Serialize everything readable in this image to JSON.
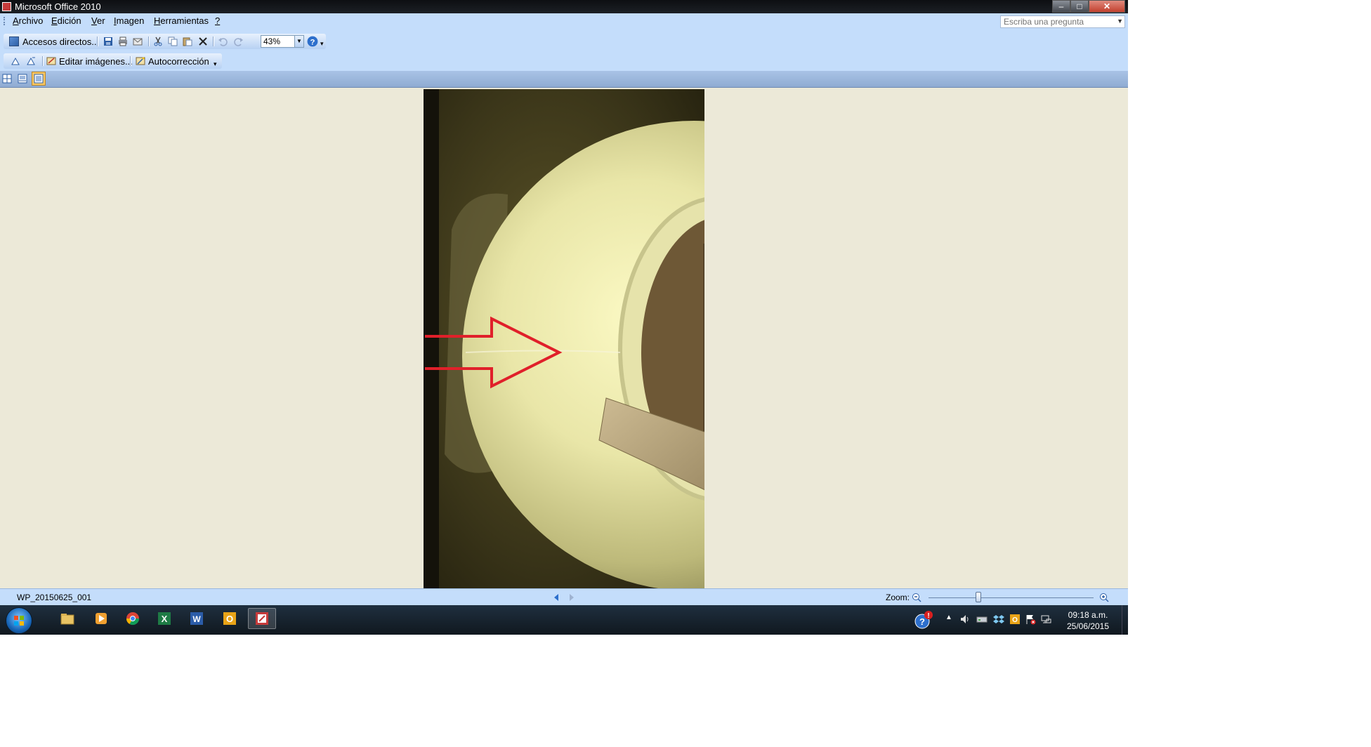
{
  "window": {
    "title": "Microsoft Office 2010",
    "controls": {
      "minimize": "–",
      "maximize": "□",
      "close": "✕"
    }
  },
  "menubar": {
    "items": [
      {
        "pre": "",
        "u": "A",
        "post": "rchivo"
      },
      {
        "pre": "",
        "u": "E",
        "post": "dición"
      },
      {
        "pre": "",
        "u": "V",
        "post": "er"
      },
      {
        "pre": "",
        "u": "I",
        "post": "magen"
      },
      {
        "pre": "",
        "u": "H",
        "post": "erramientas"
      },
      {
        "pre": "",
        "u": "?",
        "post": ""
      }
    ],
    "ask_placeholder": "Escriba una pregunta"
  },
  "toolbar": {
    "shortcuts_label": "Accesos directos...",
    "zoom_value": "43%",
    "edit_images_label": "Editar imágenes...",
    "autocorrect_label": "Autocorrección"
  },
  "statusbar": {
    "filename": "WP_20150625_001",
    "zoom_label": "Zoom:",
    "zoom_level_fraction": 0.3
  },
  "taskbar": {
    "time": "09:18 a.m.",
    "date": "25/06/2015"
  },
  "colors": {
    "chrome": "#c4ddfb",
    "viewer_bg": "#ece9d8",
    "arrow": "#e0202a"
  },
  "icons": [
    "app-icon",
    "save-icon",
    "print-icon",
    "email-icon",
    "cut-icon",
    "copy-icon",
    "paste-icon",
    "delete-icon",
    "undo-icon",
    "redo-icon",
    "help-icon",
    "rotate-left-icon",
    "rotate-right-icon",
    "edit-image-icon",
    "autocorrect-icon",
    "thumbnail-view-icon",
    "filmstrip-view-icon",
    "single-view-icon",
    "prev-icon",
    "next-icon",
    "zoom-out-icon",
    "zoom-in-icon",
    "windows-start-icon",
    "explorer-icon",
    "media-player-icon",
    "chrome-icon",
    "excel-icon",
    "word-icon",
    "outlook-icon",
    "picture-manager-icon",
    "action-center-icon",
    "volume-icon",
    "network-icon"
  ]
}
